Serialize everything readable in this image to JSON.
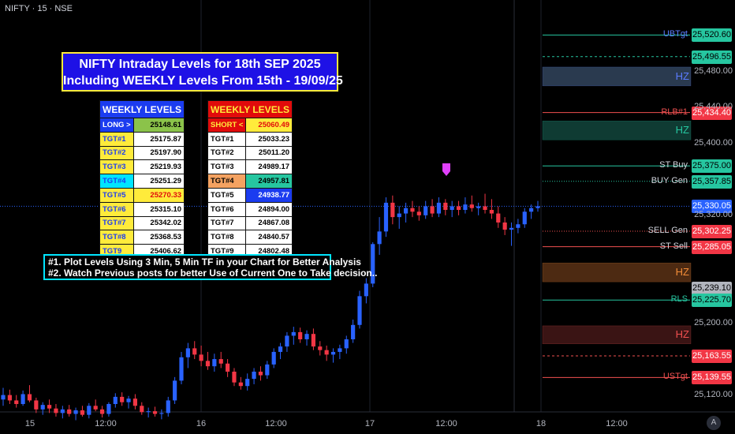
{
  "symbol": "NIFTY · 15 · NSE",
  "title": {
    "line1": "NIFTY Intraday Levels for 18th SEP 2025",
    "line2": "Including WEEKLY Levels From 15th - 19/09/25"
  },
  "weekly_long": {
    "header": "WEEKLY LEVELS",
    "rows": [
      {
        "name": "LONG >",
        "value": "25148.61",
        "bg": "#1b3cf0",
        "fg": "#ffffff",
        "vbg": "#8bc34a",
        "vfg": "#000000"
      },
      {
        "name": "TGT#1",
        "value": "25175.87",
        "bg": "#ffeb3b",
        "fg": "#1b3cf0",
        "vbg": "#ffffff",
        "vfg": "#000000"
      },
      {
        "name": "TGT#2",
        "value": "25197.90",
        "bg": "#ffeb3b",
        "fg": "#1b3cf0",
        "vbg": "#ffffff",
        "vfg": "#000000"
      },
      {
        "name": "TGT#3",
        "value": "25219.93",
        "bg": "#ffeb3b",
        "fg": "#1b3cf0",
        "vbg": "#ffffff",
        "vfg": "#000000"
      },
      {
        "name": "TGT#4",
        "value": "25251.29",
        "bg": "#00e5ff",
        "fg": "#1b3cf0",
        "vbg": "#ffffff",
        "vfg": "#000000"
      },
      {
        "name": "TGT#5",
        "value": "25270.33",
        "bg": "#ffeb3b",
        "fg": "#1b3cf0",
        "vbg": "#ffeb3b",
        "vfg": "#e10b0b"
      },
      {
        "name": "TGT#6",
        "value": "25315.10",
        "bg": "#ffeb3b",
        "fg": "#1b3cf0",
        "vbg": "#ffffff",
        "vfg": "#000000"
      },
      {
        "name": "TGT#7",
        "value": "25342.02",
        "bg": "#ffeb3b",
        "fg": "#1b3cf0",
        "vbg": "#ffffff",
        "vfg": "#000000"
      },
      {
        "name": "TGT#8",
        "value": "25368.53",
        "bg": "#ffeb3b",
        "fg": "#1b3cf0",
        "vbg": "#ffffff",
        "vfg": "#000000"
      },
      {
        "name": "TGT9",
        "value": "25406.62",
        "bg": "#ffeb3b",
        "fg": "#1b3cf0",
        "vbg": "#ffffff",
        "vfg": "#000000"
      }
    ]
  },
  "weekly_short": {
    "header": "WEEKLY LEVELS",
    "rows": [
      {
        "name": "SHORT <",
        "value": "25060.49",
        "bg": "#e10b0b",
        "fg": "#ffeb3b",
        "vbg": "#ffeb3b",
        "vfg": "#e10b0b"
      },
      {
        "name": "TGT#1",
        "value": "25033.23",
        "bg": "#ffffff",
        "fg": "#000000",
        "vbg": "#ffffff",
        "vfg": "#000000"
      },
      {
        "name": "TGT#2",
        "value": "25011.20",
        "bg": "#ffffff",
        "fg": "#000000",
        "vbg": "#ffffff",
        "vfg": "#000000"
      },
      {
        "name": "TGT#3",
        "value": "24989.17",
        "bg": "#ffffff",
        "fg": "#000000",
        "vbg": "#ffffff",
        "vfg": "#000000"
      },
      {
        "name": "TGT#4",
        "value": "24957.81",
        "bg": "#f4a261",
        "fg": "#000000",
        "vbg": "#26c6a0",
        "vfg": "#000000"
      },
      {
        "name": "TGT#5",
        "value": "24938.77",
        "bg": "#ffffff",
        "fg": "#000000",
        "vbg": "#1b3cf0",
        "vfg": "#ffffff"
      },
      {
        "name": "TGT#6",
        "value": "24894.00",
        "bg": "#ffffff",
        "fg": "#000000",
        "vbg": "#ffffff",
        "vfg": "#000000"
      },
      {
        "name": "TGT#7",
        "value": "24867.08",
        "bg": "#ffffff",
        "fg": "#000000",
        "vbg": "#ffffff",
        "vfg": "#000000"
      },
      {
        "name": "TGT#8",
        "value": "24840.57",
        "bg": "#ffffff",
        "fg": "#000000",
        "vbg": "#ffffff",
        "vfg": "#000000"
      },
      {
        "name": "TGT#9",
        "value": "24802.48",
        "bg": "#ffffff",
        "fg": "#000000",
        "vbg": "#ffffff",
        "vfg": "#000000"
      }
    ]
  },
  "notes": {
    "line1": "#1. Plot Levels Using 3 Min, 5 Min TF in your Chart for Better Analysis",
    "line2": "#2. Watch Previous posts for better Use of Current One to Take decision.."
  },
  "watermark": "A",
  "chart_data": {
    "type": "candlestick",
    "symbol": "NIFTY",
    "timeframe": "15",
    "exchange": "NSE",
    "y_ticks": [
      "25,480.00",
      "25,440.00",
      "25,400.00",
      "25,320.00",
      "25,200.00",
      "25,120.00"
    ],
    "ylim": [
      25110,
      25535
    ],
    "x_ticks": [
      "15",
      "12:00",
      "16",
      "12:00",
      "17",
      "12:00",
      "18",
      "12:00"
    ],
    "levels": [
      {
        "label": "UBTgt",
        "price": 25520.6,
        "tag": "25,520.60",
        "color": "#26c6a0",
        "style": "solid",
        "label_color": "#5b7cff",
        "tag_bg": "#26c6a0",
        "tag_fg": "#000000"
      },
      {
        "label": "",
        "price": 25496.55,
        "tag": "25,496.55",
        "color": "#26c6a0",
        "style": "dashed",
        "tag_bg": "#26c6a0",
        "tag_fg": "#000000"
      },
      {
        "label": "RLB#1",
        "price": 25434.4,
        "tag": "25,434.40",
        "color": "#f05050",
        "style": "solid",
        "label_color": "#f05050",
        "tag_bg": "#f23645",
        "tag_fg": "#ffffff"
      },
      {
        "label": "ST Buy",
        "price": 25375.0,
        "tag": "25,375.00",
        "color": "#26c6a0",
        "style": "solid",
        "label_color": "#d1d4dc",
        "tag_bg": "#26c6a0",
        "tag_fg": "#000000"
      },
      {
        "label": "BUY Gen",
        "price": 25357.85,
        "tag": "25,357.85",
        "color": "#26c6a0",
        "style": "dotted",
        "label_color": "#d1d4dc",
        "tag_bg": "#26c6a0",
        "tag_fg": "#000000"
      },
      {
        "label": "",
        "price": 25330.05,
        "tag": "25,330.05",
        "color": "#2962ff",
        "style": "dotted",
        "tag_bg": "#2962ff",
        "tag_fg": "#ffffff"
      },
      {
        "label": "SELL Gen",
        "price": 25302.25,
        "tag": "25,302.25",
        "color": "#f05050",
        "style": "dotted",
        "label_color": "#d1d4dc",
        "tag_bg": "#f23645",
        "tag_fg": "#ffffff"
      },
      {
        "label": "ST Sell",
        "price": 25285.05,
        "tag": "25,285.05",
        "color": "#f05050",
        "style": "solid",
        "label_color": "#d1d4dc",
        "tag_bg": "#f23645",
        "tag_fg": "#ffffff"
      },
      {
        "label": "",
        "price": 25239.1,
        "tag": "25,239.10",
        "color": "#787b86",
        "style": "none",
        "tag_bg": "#b2b5be",
        "tag_fg": "#000000"
      },
      {
        "label": "RLS",
        "price": 25225.7,
        "tag": "25,225.70",
        "color": "#26c6a0",
        "style": "solid",
        "label_color": "#26c6a0",
        "tag_bg": "#26c6a0",
        "tag_fg": "#000000"
      },
      {
        "label": "",
        "price": 25163.55,
        "tag": "25,163.55",
        "color": "#f05050",
        "style": "dashed",
        "tag_bg": "#f23645",
        "tag_fg": "#ffffff"
      },
      {
        "label": "USTgt",
        "price": 25139.55,
        "tag": "25,139.55",
        "color": "#f05050",
        "style": "solid",
        "label_color": "#f05050",
        "tag_bg": "#f23645",
        "tag_fg": "#ffffff"
      }
    ],
    "zones": [
      {
        "label": "HZ",
        "low": 25464,
        "high": 25485,
        "color": "#2a3a4f",
        "label_color": "#5b7cff"
      },
      {
        "label": "HZ",
        "low": 25404,
        "high": 25425,
        "color": "#0f3b33",
        "label_color": "#26c6a0"
      },
      {
        "label": "HZ",
        "low": 25246,
        "high": 25267,
        "color": "#4d2a12",
        "label_color": "#f28c38"
      },
      {
        "label": "HZ",
        "low": 25177,
        "high": 25197,
        "color": "#3a1414",
        "label_color": "#f05050"
      }
    ],
    "candles": [
      {
        "o": 25115,
        "h": 25128,
        "l": 25108,
        "c": 25120
      },
      {
        "o": 25120,
        "h": 25126,
        "l": 25110,
        "c": 25114
      },
      {
        "o": 25114,
        "h": 25120,
        "l": 25106,
        "c": 25110
      },
      {
        "o": 25110,
        "h": 25125,
        "l": 25108,
        "c": 25121
      },
      {
        "o": 25121,
        "h": 25131,
        "l": 25112,
        "c": 25114
      },
      {
        "o": 25114,
        "h": 25117,
        "l": 25100,
        "c": 25104
      },
      {
        "o": 25104,
        "h": 25112,
        "l": 25098,
        "c": 25109
      },
      {
        "o": 25109,
        "h": 25115,
        "l": 25100,
        "c": 25105
      },
      {
        "o": 25105,
        "h": 25110,
        "l": 25096,
        "c": 25100
      },
      {
        "o": 25100,
        "h": 25108,
        "l": 25094,
        "c": 25104
      },
      {
        "o": 25104,
        "h": 25109,
        "l": 25096,
        "c": 25099
      },
      {
        "o": 25099,
        "h": 25106,
        "l": 25092,
        "c": 25103
      },
      {
        "o": 25103,
        "h": 25108,
        "l": 25096,
        "c": 25098
      },
      {
        "o": 25098,
        "h": 25111,
        "l": 25094,
        "c": 25108
      },
      {
        "o": 25108,
        "h": 25115,
        "l": 25102,
        "c": 25104
      },
      {
        "o": 25104,
        "h": 25108,
        "l": 25095,
        "c": 25099
      },
      {
        "o": 25099,
        "h": 25112,
        "l": 25096,
        "c": 25110
      },
      {
        "o": 25110,
        "h": 25122,
        "l": 25106,
        "c": 25118
      },
      {
        "o": 25118,
        "h": 25123,
        "l": 25108,
        "c": 25112
      },
      {
        "o": 25112,
        "h": 25119,
        "l": 25105,
        "c": 25116
      },
      {
        "o": 25116,
        "h": 25121,
        "l": 25104,
        "c": 25108
      },
      {
        "o": 25108,
        "h": 25112,
        "l": 25098,
        "c": 25101
      },
      {
        "o": 25101,
        "h": 25106,
        "l": 25095,
        "c": 25102
      },
      {
        "o": 25102,
        "h": 25107,
        "l": 25096,
        "c": 25099
      },
      {
        "o": 25099,
        "h": 25104,
        "l": 25093,
        "c": 25100
      },
      {
        "o": 25100,
        "h": 25118,
        "l": 25096,
        "c": 25114
      },
      {
        "o": 25114,
        "h": 25140,
        "l": 25110,
        "c": 25136
      },
      {
        "o": 25136,
        "h": 25168,
        "l": 25132,
        "c": 25162
      },
      {
        "o": 25162,
        "h": 25178,
        "l": 25150,
        "c": 25172
      },
      {
        "o": 25172,
        "h": 25180,
        "l": 25160,
        "c": 25165
      },
      {
        "o": 25165,
        "h": 25175,
        "l": 25152,
        "c": 25158
      },
      {
        "o": 25158,
        "h": 25168,
        "l": 25148,
        "c": 25152
      },
      {
        "o": 25152,
        "h": 25166,
        "l": 25146,
        "c": 25160
      },
      {
        "o": 25160,
        "h": 25168,
        "l": 25150,
        "c": 25155
      },
      {
        "o": 25155,
        "h": 25160,
        "l": 25140,
        "c": 25146
      },
      {
        "o": 25146,
        "h": 25150,
        "l": 25130,
        "c": 25134
      },
      {
        "o": 25134,
        "h": 25140,
        "l": 25126,
        "c": 25130
      },
      {
        "o": 25130,
        "h": 25144,
        "l": 25125,
        "c": 25138
      },
      {
        "o": 25138,
        "h": 25150,
        "l": 25132,
        "c": 25146
      },
      {
        "o": 25146,
        "h": 25152,
        "l": 25136,
        "c": 25142
      },
      {
        "o": 25142,
        "h": 25158,
        "l": 25138,
        "c": 25154
      },
      {
        "o": 25154,
        "h": 25172,
        "l": 25150,
        "c": 25168
      },
      {
        "o": 25168,
        "h": 25178,
        "l": 25160,
        "c": 25174
      },
      {
        "o": 25174,
        "h": 25190,
        "l": 25168,
        "c": 25186
      },
      {
        "o": 25186,
        "h": 25196,
        "l": 25176,
        "c": 25190
      },
      {
        "o": 25190,
        "h": 25195,
        "l": 25178,
        "c": 25182
      },
      {
        "o": 25182,
        "h": 25192,
        "l": 25175,
        "c": 25188
      },
      {
        "o": 25188,
        "h": 25194,
        "l": 25170,
        "c": 25174
      },
      {
        "o": 25174,
        "h": 25180,
        "l": 25164,
        "c": 25170
      },
      {
        "o": 25170,
        "h": 25175,
        "l": 25158,
        "c": 25165
      },
      {
        "o": 25165,
        "h": 25172,
        "l": 25156,
        "c": 25168
      },
      {
        "o": 25168,
        "h": 25176,
        "l": 25160,
        "c": 25172
      },
      {
        "o": 25172,
        "h": 25186,
        "l": 25166,
        "c": 25182
      },
      {
        "o": 25182,
        "h": 25204,
        "l": 25178,
        "c": 25198
      },
      {
        "o": 25198,
        "h": 25236,
        "l": 25194,
        "c": 25230
      },
      {
        "o": 25230,
        "h": 25250,
        "l": 25222,
        "c": 25244
      },
      {
        "o": 25244,
        "h": 25290,
        "l": 25240,
        "c": 25288
      },
      {
        "o": 25288,
        "h": 25318,
        "l": 25276,
        "c": 25302
      },
      {
        "o": 25302,
        "h": 25340,
        "l": 25296,
        "c": 25334
      },
      {
        "o": 25334,
        "h": 25342,
        "l": 25310,
        "c": 25318
      },
      {
        "o": 25318,
        "h": 25330,
        "l": 25305,
        "c": 25322
      },
      {
        "o": 25322,
        "h": 25334,
        "l": 25312,
        "c": 25328
      },
      {
        "o": 25328,
        "h": 25336,
        "l": 25318,
        "c": 25324
      },
      {
        "o": 25324,
        "h": 25330,
        "l": 25314,
        "c": 25320
      },
      {
        "o": 25320,
        "h": 25336,
        "l": 25316,
        "c": 25330
      },
      {
        "o": 25330,
        "h": 25338,
        "l": 25318,
        "c": 25322
      },
      {
        "o": 25322,
        "h": 25340,
        "l": 25318,
        "c": 25334
      },
      {
        "o": 25334,
        "h": 25338,
        "l": 25320,
        "c": 25326
      },
      {
        "o": 25326,
        "h": 25336,
        "l": 25318,
        "c": 25330
      },
      {
        "o": 25330,
        "h": 25336,
        "l": 25320,
        "c": 25326
      },
      {
        "o": 25326,
        "h": 25340,
        "l": 25322,
        "c": 25332
      },
      {
        "o": 25332,
        "h": 25342,
        "l": 25324,
        "c": 25328
      },
      {
        "o": 25328,
        "h": 25334,
        "l": 25320,
        "c": 25330
      },
      {
        "o": 25330,
        "h": 25344,
        "l": 25322,
        "c": 25326
      },
      {
        "o": 25326,
        "h": 25338,
        "l": 25316,
        "c": 25322
      },
      {
        "o": 25322,
        "h": 25330,
        "l": 25306,
        "c": 25312
      },
      {
        "o": 25312,
        "h": 25318,
        "l": 25298,
        "c": 25304
      },
      {
        "o": 25304,
        "h": 25312,
        "l": 25286,
        "c": 25306
      },
      {
        "o": 25306,
        "h": 25316,
        "l": 25300,
        "c": 25310
      },
      {
        "o": 25310,
        "h": 25328,
        "l": 25306,
        "c": 25324
      },
      {
        "o": 25324,
        "h": 25332,
        "l": 25316,
        "c": 25328
      },
      {
        "o": 25328,
        "h": 25336,
        "l": 25324,
        "c": 25330
      }
    ],
    "colors": {
      "up": "#2962ff",
      "down": "#f23645",
      "background": "#000000"
    }
  }
}
